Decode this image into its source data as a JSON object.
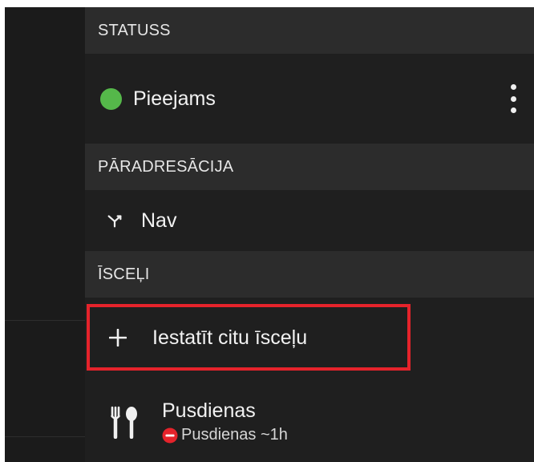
{
  "panel": {
    "status": {
      "header": "STATUSS",
      "current": "Pieejams",
      "status_color": "#55b84a",
      "menu_icon": "more-vert-icon"
    },
    "forwarding": {
      "header": "PĀRADRESĀCIJA",
      "current": "Nav",
      "icon": "call-forward-icon"
    },
    "shortcuts": {
      "header": "ĪSCEĻI",
      "add_label": "Iestatīt citu īsceļu",
      "add_icon": "plus-icon",
      "items": [
        {
          "title": "Pusdienas",
          "subtitle": "Pusdienas ~1h",
          "icon": "fork-spoon-icon",
          "badge_icon": "do-not-disturb-icon",
          "badge_color": "#e5232b"
        }
      ]
    }
  },
  "highlight_color": "#e5232b"
}
